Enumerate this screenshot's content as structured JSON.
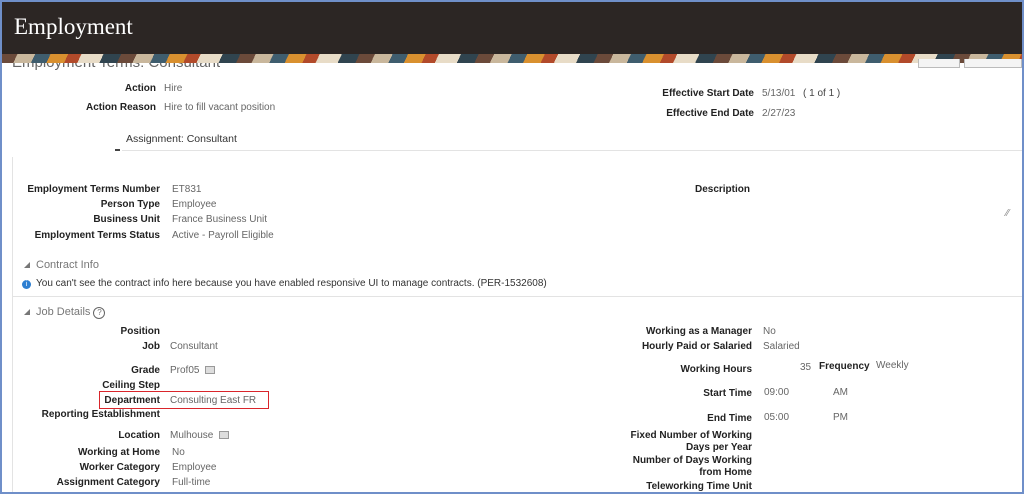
{
  "header": {
    "title": "Employment"
  },
  "page_title": "Employment Terms: Consultant",
  "top": {
    "action_label": "Action",
    "action": "Hire",
    "reason_label": "Action Reason",
    "reason": "Hire to fill vacant position",
    "start_label": "Effective Start Date",
    "start": "5/13/01",
    "range": "( 1 of 1 )",
    "end_label": "Effective End Date",
    "end": "2/27/23",
    "assignment": "Assignment: Consultant"
  },
  "terms": {
    "number_label": "Employment Terms Number",
    "number": "ET831",
    "ptype_label": "Person Type",
    "ptype": "Employee",
    "bu_label": "Business Unit",
    "bu": "France Business Unit",
    "status_label": "Employment Terms Status",
    "status": "Active - Payroll Eligible",
    "desc_label": "Description"
  },
  "contract": {
    "title": "Contract Info",
    "message": "You can't see the contract info here because you have enabled responsive UI to manage contracts. (PER-1532608)"
  },
  "job": {
    "title": "Job Details",
    "position_label": "Position",
    "job_label": "Job",
    "job": "Consultant",
    "grade_label": "Grade",
    "grade": "Prof05",
    "ceiling_label": "Ceiling Step",
    "dept_label": "Department",
    "dept": "Consulting East FR",
    "rep_label": "Reporting Establishment",
    "loc_label": "Location",
    "loc": "Mulhouse",
    "home_label": "Working at Home",
    "home": "No",
    "wcat_label": "Worker Category",
    "wcat": "Employee",
    "acat_label": "Assignment Category",
    "acat": "Full-time",
    "mgr_label": "Working as a Manager",
    "mgr": "No",
    "hourly_label": "Hourly Paid or Salaried",
    "hourly": "Salaried",
    "hours_label": "Working Hours",
    "hours": "35",
    "freq_label": "Frequency",
    "freq": "Weekly",
    "st_label": "Start Time",
    "st": "09:00",
    "st_ampm": "AM",
    "et_label": "End Time",
    "et": "05:00",
    "et_ampm": "PM",
    "fixed_label1": "Fixed Number of Working",
    "fixed_label2": "Days per Year",
    "ndays_label1": "Number of Days Working",
    "ndays_label2": "from Home",
    "tele_label": "Teleworking Time Unit"
  },
  "colors": {
    "highlight": "#d9252b",
    "info": "#2e7fd1"
  }
}
